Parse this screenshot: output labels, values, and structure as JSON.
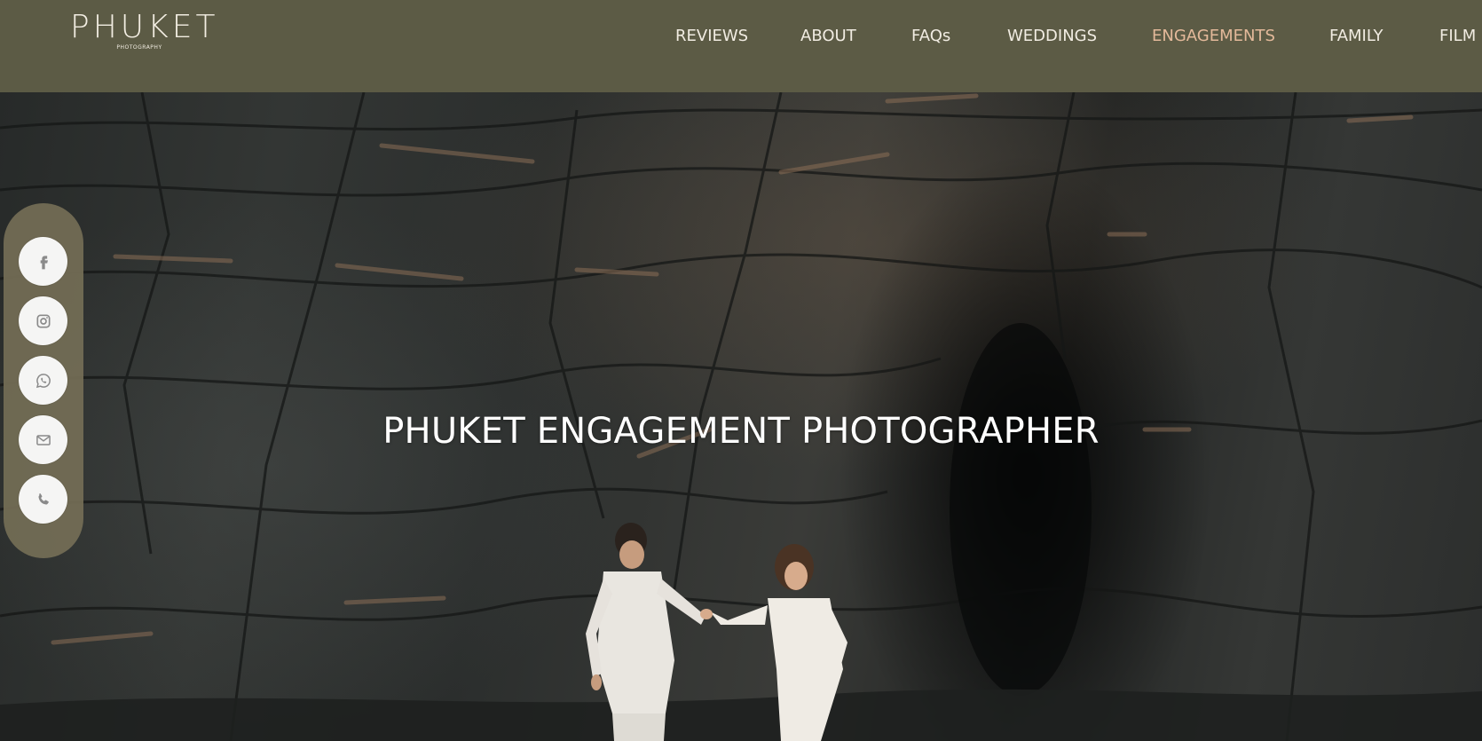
{
  "header": {
    "logo": {
      "main": "PHUKET",
      "sub": "PHOTOGRAPHY"
    },
    "nav": [
      {
        "label": "REVIEWS",
        "active": false
      },
      {
        "label": "ABOUT",
        "active": false
      },
      {
        "label": "FAQs",
        "active": false
      },
      {
        "label": "WEDDINGS",
        "active": false
      },
      {
        "label": "ENGAGEMENTS",
        "active": true
      },
      {
        "label": "FAMILY",
        "active": false
      },
      {
        "label": "FILM",
        "active": false
      }
    ]
  },
  "hero": {
    "title": "PHUKET ENGAGEMENT PHOTOGRAPHER"
  },
  "social": [
    {
      "name": "facebook",
      "icon": "facebook-icon"
    },
    {
      "name": "instagram",
      "icon": "instagram-icon"
    },
    {
      "name": "whatsapp",
      "icon": "whatsapp-icon"
    },
    {
      "name": "email",
      "icon": "mail-icon"
    },
    {
      "name": "phone",
      "icon": "phone-icon"
    }
  ],
  "colors": {
    "header_bg": "#5c5b45",
    "nav_text": "#f1ece2",
    "nav_active": "#e3b99a",
    "sidebar_bg": "#746e56",
    "social_button_bg": "#f5f5f4",
    "social_icon": "#8a8a8a"
  }
}
